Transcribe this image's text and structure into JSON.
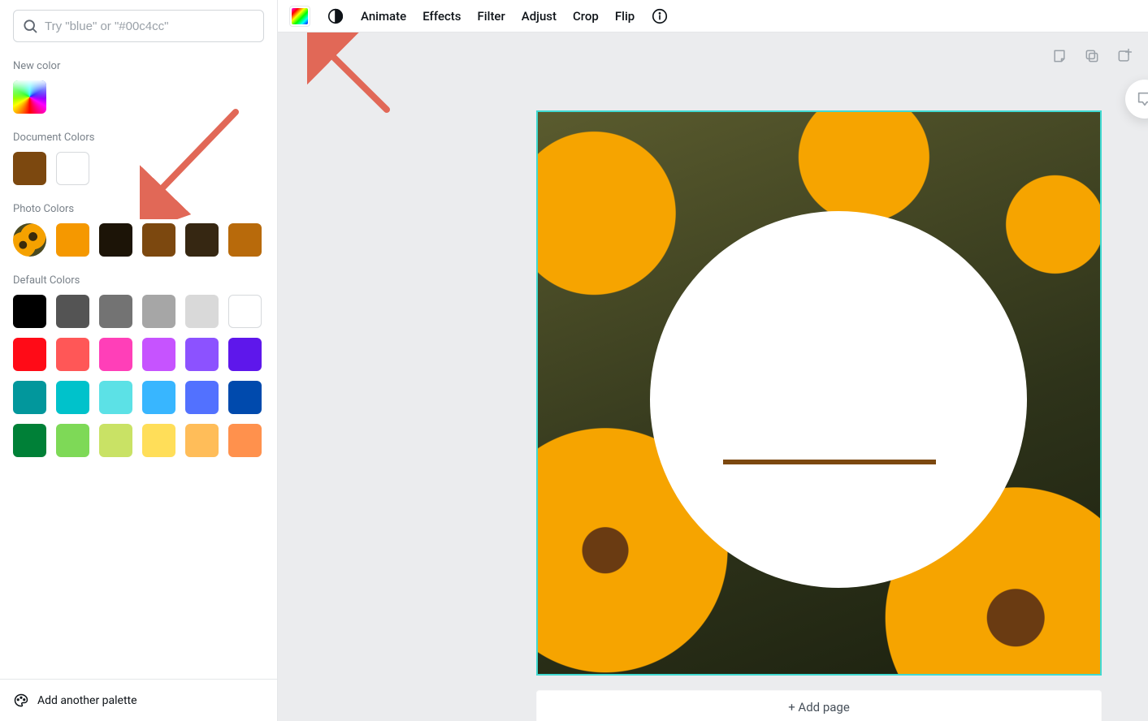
{
  "sidebar": {
    "search_placeholder": "Try \"blue\" or \"#00c4cc\"",
    "sections": {
      "new_color": "New color",
      "document_colors": "Document Colors",
      "photo_colors": "Photo Colors",
      "default_colors": "Default Colors"
    },
    "document_colors": [
      "#7c480f",
      "#ffffff"
    ],
    "photo_colors": [
      "photo-thumb",
      "#f59800",
      "#1c1407",
      "#7c480f",
      "#362712",
      "#b86a0b"
    ],
    "default_colors_rows": [
      [
        "#000000",
        "#545454",
        "#737373",
        "#a6a6a6",
        "#d9d9d9",
        "#ffffff"
      ],
      [
        "#ff0b17",
        "#ff5757",
        "#ff3fb8",
        "#c653ff",
        "#8c52ff",
        "#5e17eb"
      ],
      [
        "#02979c",
        "#00c2cb",
        "#5ce1e6",
        "#38b6ff",
        "#5271ff",
        "#004aad"
      ],
      [
        "#008037",
        "#7ed957",
        "#c9e265",
        "#ffde59",
        "#ffbd59",
        "#ff914d"
      ]
    ],
    "footer_label": "Add another palette"
  },
  "toolbar": {
    "animate": "Animate",
    "effects": "Effects",
    "filter": "Filter",
    "adjust": "Adjust",
    "crop": "Crop",
    "flip": "Flip"
  },
  "canvas": {
    "add_page_label": "+ Add page",
    "design_line_color": "#7c480f",
    "selection_border_color": "#41d9d1"
  }
}
